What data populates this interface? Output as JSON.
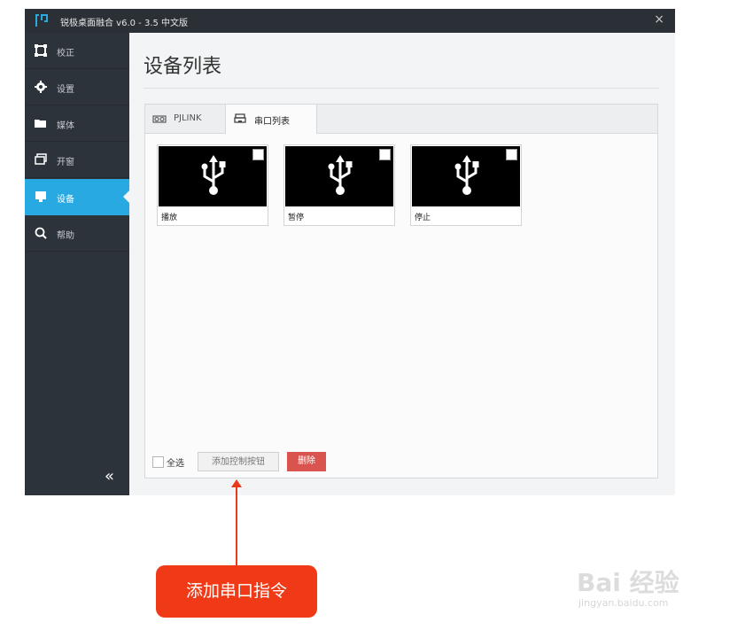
{
  "window": {
    "title": "锐极桌面融合 v6.0 - 3.5 中文版",
    "close_label": "×"
  },
  "sidebar": {
    "items": [
      {
        "label": "校正",
        "icon": "calibrate-icon"
      },
      {
        "label": "设置",
        "icon": "gear-icon"
      },
      {
        "label": "媒体",
        "icon": "folder-icon"
      },
      {
        "label": "开窗",
        "icon": "window-icon"
      },
      {
        "label": "设备",
        "icon": "monitor-icon",
        "active": true
      },
      {
        "label": "帮助",
        "icon": "search-icon"
      }
    ],
    "collapse_label": "«"
  },
  "main": {
    "title": "设备列表",
    "tabs": [
      {
        "label": "PJLINK",
        "icon": "projector-icon"
      },
      {
        "label": "串口列表",
        "icon": "serial-icon",
        "active": true
      }
    ],
    "cards": [
      {
        "name": "播放",
        "icon": "usb-icon"
      },
      {
        "name": "暂停",
        "icon": "usb-icon"
      },
      {
        "name": "停止",
        "icon": "usb-icon"
      }
    ],
    "footer": {
      "select_all": "全选",
      "add_button": "添加控制按钮",
      "delete_button": "删除"
    }
  },
  "annotation": {
    "callout": "添加串口指令"
  },
  "watermark": {
    "logo": "Bai 经验",
    "url": "jingyan.baidu.com"
  },
  "colors": {
    "sidebar_bg": "#2d333b",
    "accent": "#29a9e1",
    "delete": "#d9534f",
    "callout": "#f03a17"
  }
}
